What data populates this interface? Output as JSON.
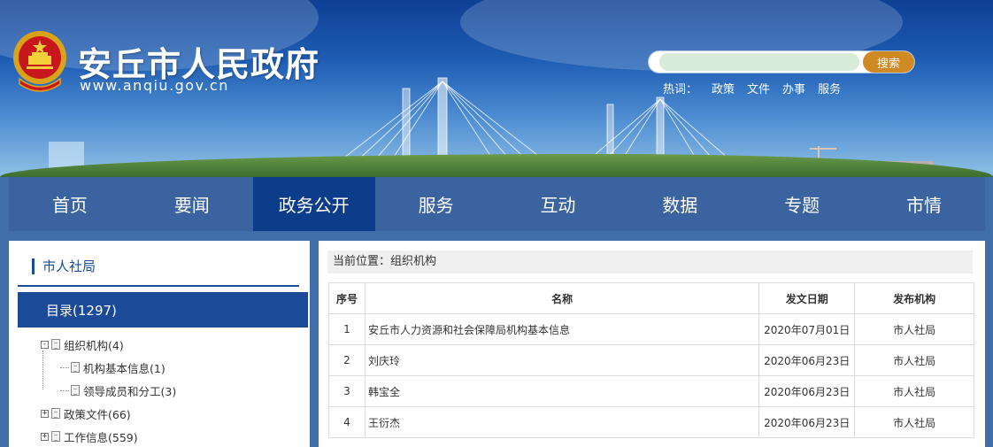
{
  "header": {
    "title": "安丘市人民政府",
    "url": "www.anqiu.gov.cn",
    "emblem_icon": "national-emblem-icon"
  },
  "search": {
    "value": "",
    "placeholder": "",
    "button_label": "搜索",
    "hot_label": "热词：",
    "hot_words": [
      "政策",
      "文件",
      "办事",
      "服务"
    ]
  },
  "nav": {
    "items": [
      "首页",
      "要闻",
      "政务公开",
      "服务",
      "互动",
      "数据",
      "专题",
      "市情"
    ],
    "active": "政务公开"
  },
  "sidebar": {
    "title": "市人社局",
    "catalog_label": "目录(1297)",
    "tree": [
      {
        "label": "组织机构(4)",
        "toggle": "-"
      },
      {
        "label": "机构基本信息(1)",
        "toggle": ""
      },
      {
        "label": "领导成员和分工(3)",
        "toggle": ""
      },
      {
        "label": "政策文件(66)",
        "toggle": "+"
      },
      {
        "label": "工作信息(559)",
        "toggle": "+"
      }
    ]
  },
  "main": {
    "breadcrumb": "当前位置：组织机构",
    "columns": [
      "序号",
      "名称",
      "发文日期",
      "发布机构"
    ],
    "rows": [
      {
        "no": "1",
        "name": "安丘市人力资源和社会保障局机构基本信息",
        "date": "2020年07月01日",
        "org": "市人社局"
      },
      {
        "no": "2",
        "name": "刘庆玲",
        "date": "2020年06月23日",
        "org": "市人社局"
      },
      {
        "no": "3",
        "name": "韩宝全",
        "date": "2020年06月23日",
        "org": "市人社局"
      },
      {
        "no": "4",
        "name": "王衍杰",
        "date": "2020年06月23日",
        "org": "市人社局"
      }
    ]
  },
  "colors": {
    "nav_bg": "#3a63a0",
    "nav_active": "#0d3c8a",
    "accent_blue": "#1a4a98",
    "search_button": "#d08a24"
  }
}
